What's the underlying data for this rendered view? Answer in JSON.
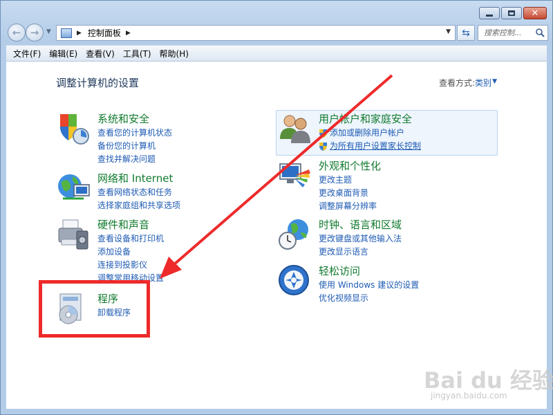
{
  "window": {
    "controls": {
      "minimize": "minimize",
      "maximize": "maximize",
      "close": "✕"
    }
  },
  "nav": {
    "address_path": "控制面板",
    "search_placeholder": "搜索控制..."
  },
  "menu": [
    "文件(F)",
    "编辑(E)",
    "查看(V)",
    "工具(T)",
    "帮助(H)"
  ],
  "main": {
    "title": "调整计算机的设置",
    "view_by_label": "查看方式:",
    "view_by_value": "类别"
  },
  "categories": [
    {
      "title": "系统和安全",
      "icon": "shield-icon",
      "links": [
        "查看您的计算机状态",
        "备份您的计算机",
        "查找并解决问题"
      ]
    },
    {
      "title": "网络和 Internet",
      "icon": "globe-network-icon",
      "links": [
        "查看网络状态和任务",
        "选择家庭组和共享选项"
      ]
    },
    {
      "title": "硬件和声音",
      "icon": "printer-icon",
      "links": [
        "查看设备和打印机",
        "添加设备",
        "连接到投影仪",
        "调整常用移动设置"
      ]
    },
    {
      "title": "程序",
      "icon": "programs-icon",
      "links": [
        "卸载程序"
      ]
    },
    {
      "title": "用户帐户和家庭安全",
      "icon": "users-icon",
      "links": [
        "添加或删除用户帐户",
        "为所有用户设置家长控制"
      ]
    },
    {
      "title": "外观和个性化",
      "icon": "display-palette-icon",
      "links": [
        "更改主题",
        "更改桌面背景",
        "调整屏幕分辨率"
      ]
    },
    {
      "title": "时钟、语言和区域",
      "icon": "clock-globe-icon",
      "links": [
        "更改键盘或其他输入法",
        "更改显示语言"
      ]
    },
    {
      "title": "轻松访问",
      "icon": "ease-of-access-icon",
      "links": [
        "使用 Windows 建议的设置",
        "优化视频显示"
      ]
    }
  ],
  "annotation": {
    "color": "#ee2a2a"
  },
  "watermark": {
    "text": "Bai du 经验",
    "sub": "jingyan.baidu.com"
  },
  "colors": {
    "link": "#1e5bb3",
    "category_title": "#107a2e",
    "title": "#1e395b"
  }
}
